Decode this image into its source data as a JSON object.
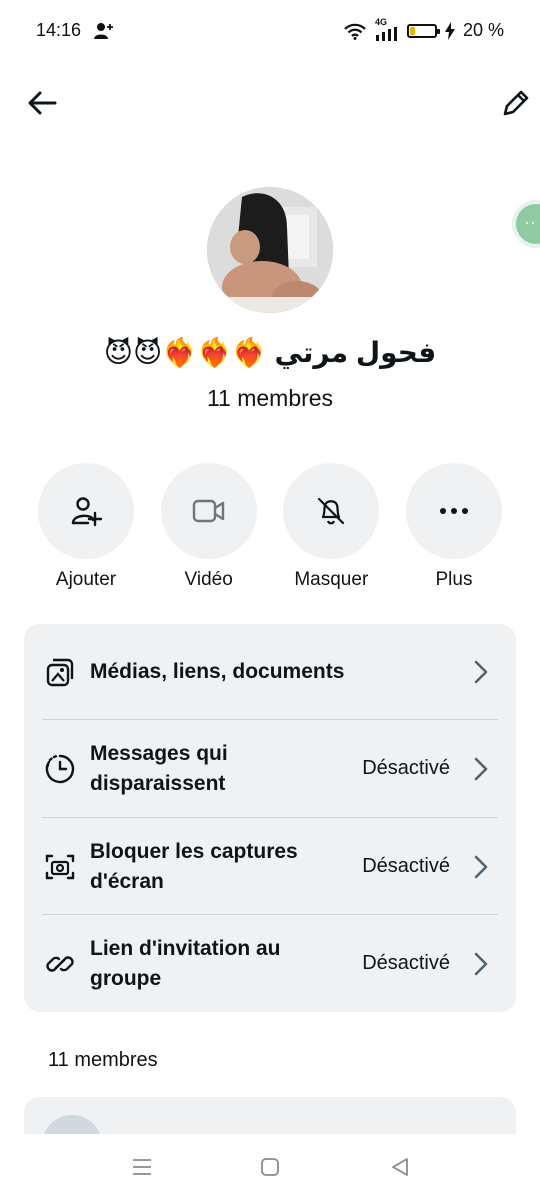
{
  "status_bar": {
    "time": "14:16",
    "network": "4G",
    "battery_percent_text": "20 %",
    "battery_level": 0.2
  },
  "header": {
    "back_icon": "arrow-left-icon",
    "edit_icon": "pencil-icon"
  },
  "group": {
    "name": "فحول مرتي ❤️‍🔥❤️‍🔥❤️‍🔥😈😈",
    "members_line": "11 membres"
  },
  "actions": [
    {
      "label": "Ajouter",
      "icon": "add-person-icon"
    },
    {
      "label": "Vidéo",
      "icon": "video-camera-icon"
    },
    {
      "label": "Masquer",
      "icon": "bell-off-icon"
    },
    {
      "label": "Plus",
      "icon": "more-dots-icon"
    }
  ],
  "settings": [
    {
      "label": "Médias, liens, documents",
      "value": "",
      "icon": "media-gallery-icon"
    },
    {
      "label": "Messages qui disparaissent",
      "value": "Désactivé",
      "icon": "timer-icon"
    },
    {
      "label": "Bloquer les captures d'écran",
      "value": "Désactivé",
      "icon": "screenshot-camera-icon"
    },
    {
      "label": "Lien d'invitation au groupe",
      "value": "Désactivé",
      "icon": "link-icon"
    }
  ],
  "members_section": {
    "title": "11 membres"
  },
  "colors": {
    "background": "#ffffff",
    "card": "#eff1f3",
    "text": "#0f1419",
    "divider": "#c9d3da",
    "battery": "#e8b400"
  }
}
